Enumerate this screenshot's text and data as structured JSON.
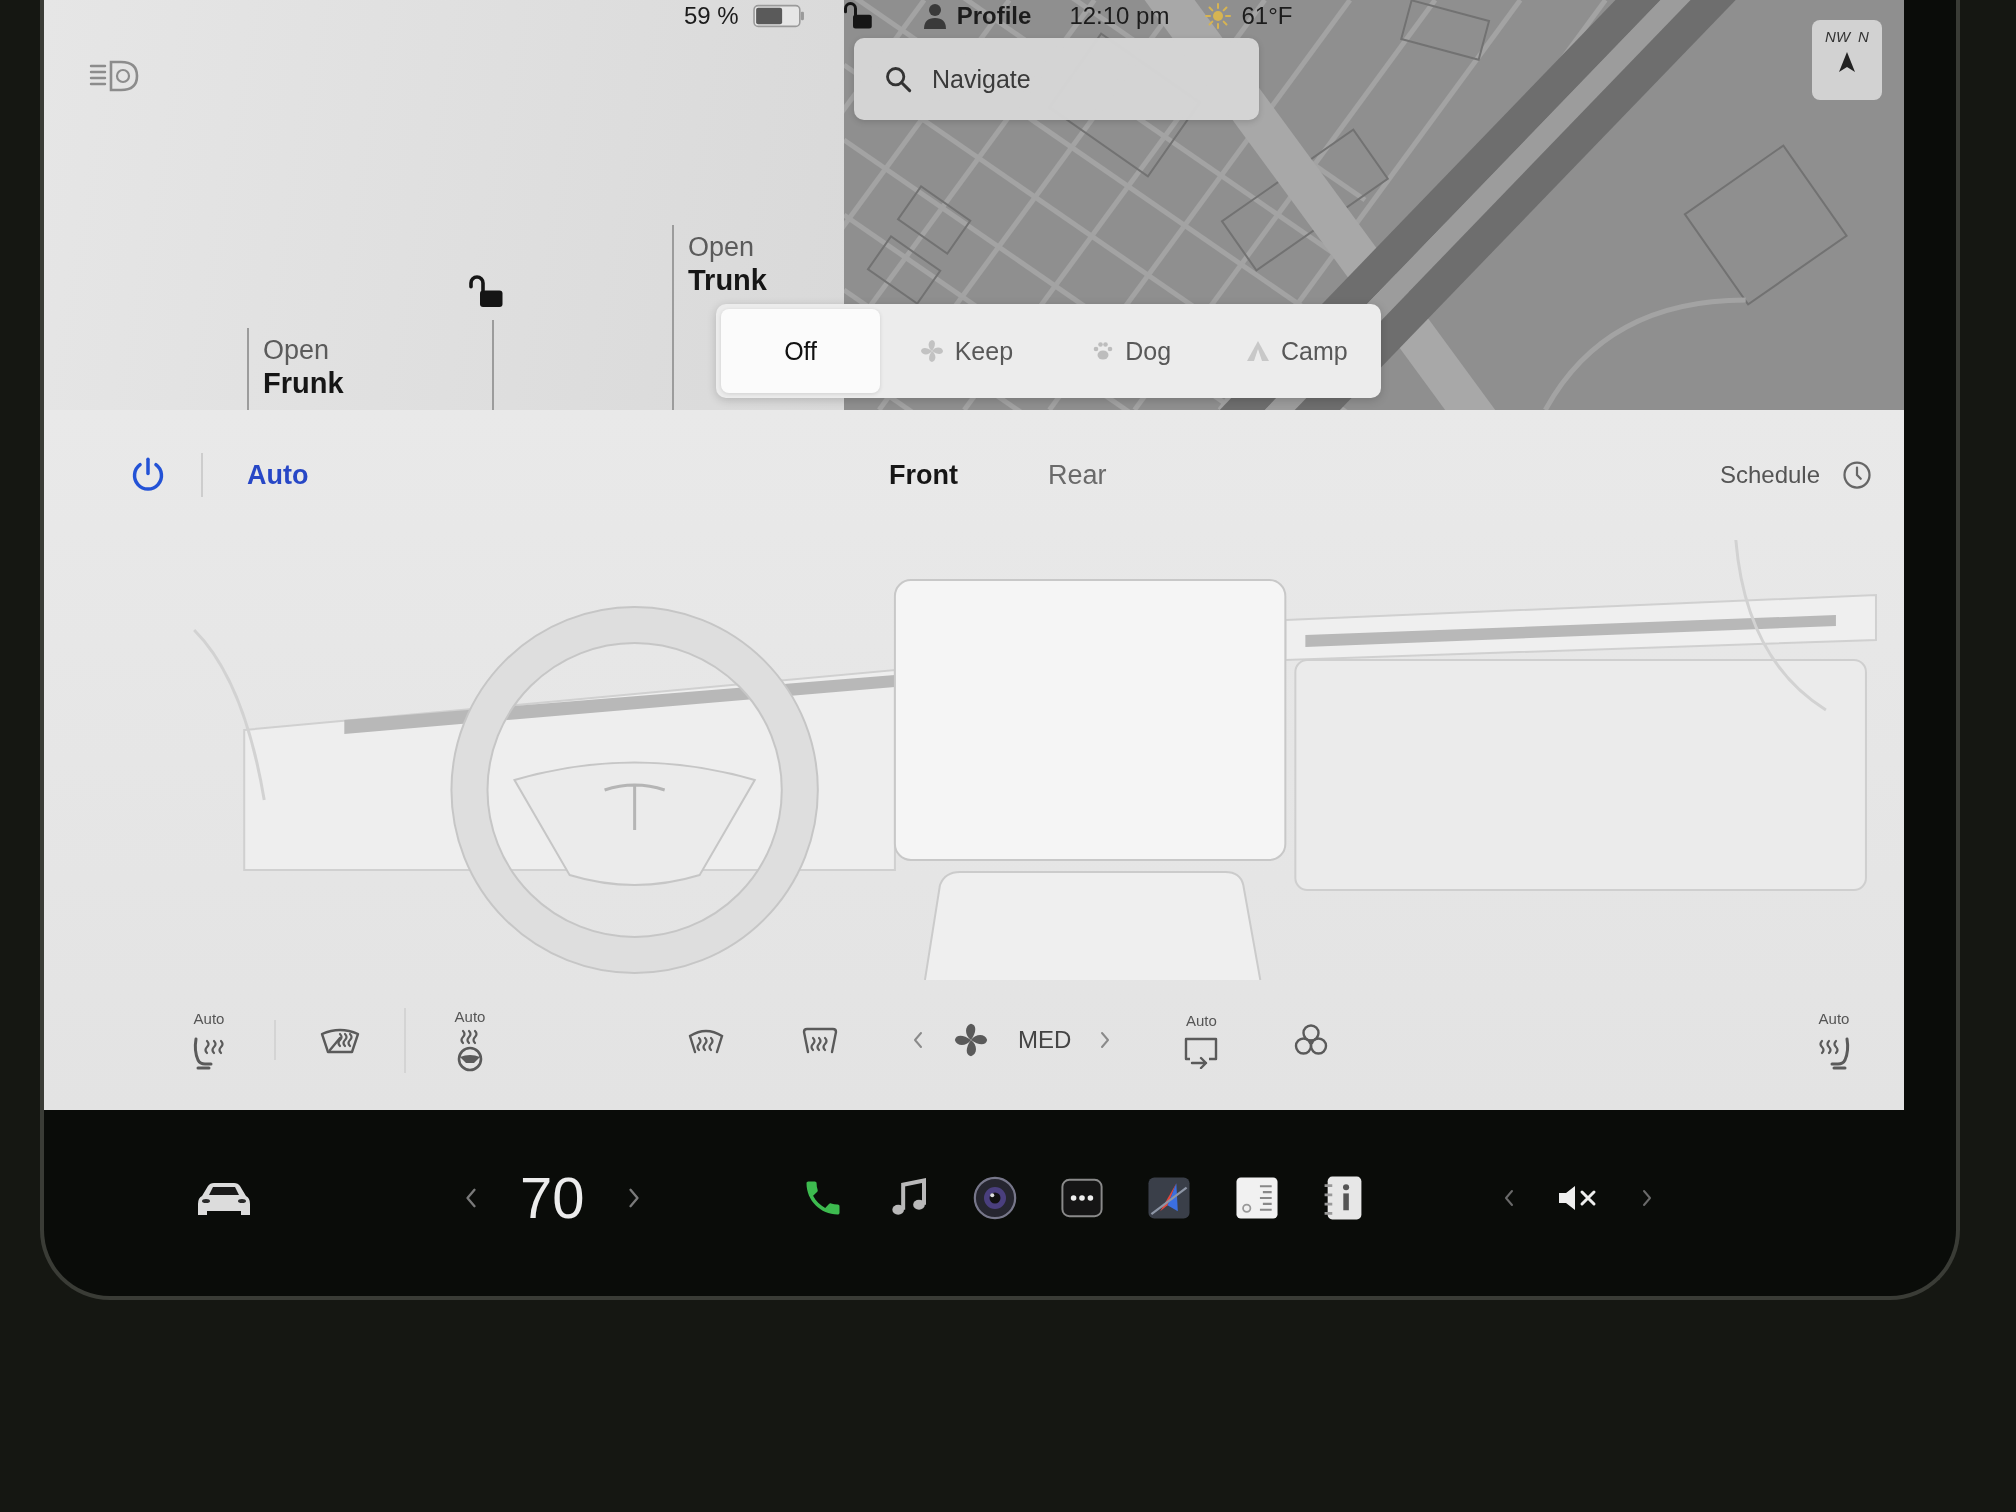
{
  "status_bar": {
    "battery": "59 %",
    "locked": false,
    "profile": "Profile",
    "time": "12:10 pm",
    "weather": "61°F"
  },
  "car_panel": {
    "actions": [
      {
        "line_1": "Open",
        "line_2": "Frunk"
      },
      {
        "line_1": "Open",
        "line_2": "Trunk"
      }
    ],
    "locked": false
  },
  "map": {
    "search": {
      "placeholder": "Navigate"
    },
    "compass": [
      "NW",
      "N"
    ]
  },
  "climate_keeper": {
    "options": [
      {
        "label": "Off",
        "kind": "off",
        "selected": true
      },
      {
        "label": "Keep",
        "kind": "keep",
        "selected": false
      },
      {
        "label": "Dog",
        "kind": "dog",
        "selected": false
      },
      {
        "label": "Camp",
        "kind": "camp",
        "selected": false
      }
    ]
  },
  "climate": {
    "power_on": true,
    "auto": {
      "label": "Auto",
      "on": true
    },
    "tabs": [
      {
        "label": "Front",
        "selected": true
      },
      {
        "label": "Rear",
        "selected": false
      }
    ],
    "schedule": "Schedule",
    "left_controls": [
      {
        "kind": "driver_seat",
        "label": "Auto"
      },
      {
        "kind": "wiper_defrost"
      },
      {
        "kind": "wheel_heater",
        "label": "Auto"
      }
    ],
    "center_controls": [
      {
        "kind": "front_defrost"
      },
      {
        "kind": "rear_defrost"
      },
      {
        "kind": "fan",
        "label": "MED"
      },
      {
        "kind": "recirculate",
        "label": "Auto"
      },
      {
        "kind": "bioweapon"
      }
    ],
    "right_controls": [
      {
        "kind": "passenger_seat",
        "label": "Auto"
      }
    ]
  },
  "taskbar": {
    "temperature": "70",
    "apps": [
      {
        "kind": "phone"
      },
      {
        "kind": "music"
      },
      {
        "kind": "camera"
      },
      {
        "kind": "more"
      },
      {
        "kind": "navigation"
      },
      {
        "kind": "notes"
      },
      {
        "kind": "manual"
      }
    ],
    "muted": true
  }
}
